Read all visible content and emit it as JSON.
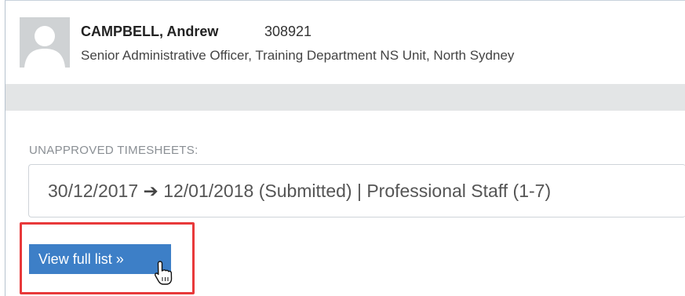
{
  "employee": {
    "name": "CAMPBELL, Andrew",
    "id": "308921",
    "role": "Senior Administrative Officer, Training Department NS Unit, North Sydney"
  },
  "timesheets": {
    "section_label": "UNAPPROVED TIMESHEETS:",
    "entry": {
      "start": "30/12/2017",
      "arrow": "➔",
      "end": "12/01/2018 (Submitted) | Professional Staff (1-7)"
    },
    "view_button_label": "View full list »"
  },
  "colors": {
    "accent": "#3d7fc7",
    "highlight": "#e8393a",
    "band": "#e3e5e6"
  },
  "icons": [
    "avatar-placeholder-icon",
    "hand-pointer-icon"
  ]
}
